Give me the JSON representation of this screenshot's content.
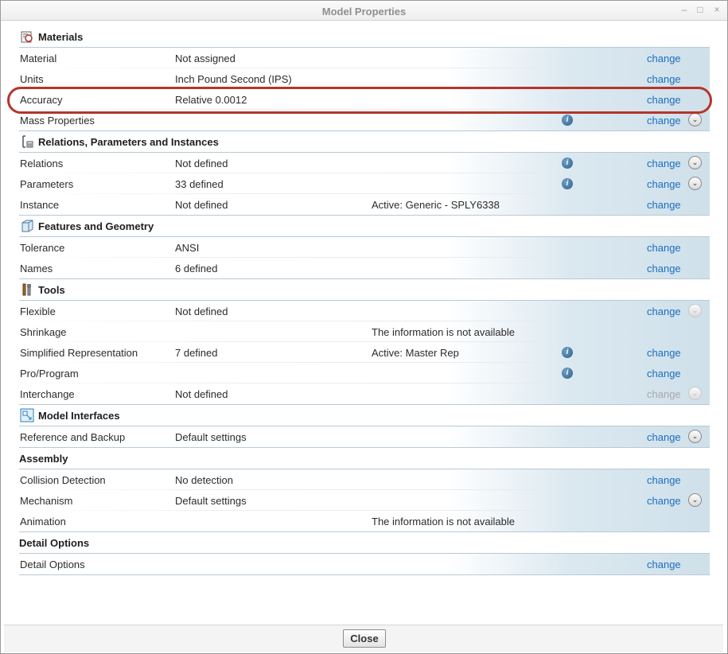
{
  "window": {
    "title": "Model Properties",
    "minimize": "–",
    "maximize": "□",
    "close": "×"
  },
  "sections": {
    "materials": {
      "title": "Materials",
      "icon": "materials-icon",
      "rows": [
        {
          "name": "Material",
          "value": "Not assigned",
          "change": "change"
        },
        {
          "name": "Units",
          "value": "Inch Pound Second (IPS)",
          "change": "change"
        },
        {
          "name": "Accuracy",
          "value": "Relative 0.0012",
          "change": "change"
        },
        {
          "name": "Mass Properties",
          "help": "i",
          "change": "change",
          "expand": "⌄"
        }
      ]
    },
    "relations": {
      "title": "Relations, Parameters and Instances",
      "icon": "relations-icon",
      "rows": [
        {
          "name": "Relations",
          "value": "Not defined",
          "help": "i",
          "change": "change",
          "expand": "⌄"
        },
        {
          "name": "Parameters",
          "value": "33 defined",
          "help": "i",
          "change": "change",
          "expand": "⌄"
        },
        {
          "name": "Instance",
          "value": "Not defined",
          "info": "Active: Generic - SPLY6338",
          "change": "change"
        }
      ]
    },
    "features": {
      "title": "Features and Geometry",
      "icon": "features-icon",
      "rows": [
        {
          "name": "Tolerance",
          "value": "ANSI",
          "change": "change"
        },
        {
          "name": "Names",
          "value": "6 defined",
          "change": "change"
        }
      ]
    },
    "tools": {
      "title": "Tools",
      "icon": "tools-icon",
      "rows": [
        {
          "name": "Flexible",
          "value": "Not defined",
          "change": "change",
          "expand": "⌄"
        },
        {
          "name": "Shrinkage",
          "info": "The information is not available"
        },
        {
          "name": "Simplified Representation",
          "value": "7 defined",
          "info": "Active: Master Rep",
          "help": "i",
          "change": "change"
        },
        {
          "name": "Pro/Program",
          "help": "i",
          "change": "change"
        },
        {
          "name": "Interchange",
          "value": "Not defined",
          "change": "change",
          "expand": "⌄"
        }
      ]
    },
    "interfaces": {
      "title": "Model Interfaces",
      "icon": "model-interfaces-icon",
      "rows": [
        {
          "name": "Reference and Backup",
          "value": "Default settings",
          "change": "change",
          "expand": "⌄"
        }
      ]
    },
    "assembly": {
      "title": "Assembly",
      "rows": [
        {
          "name": "Collision Detection",
          "value": "No detection",
          "change": "change"
        },
        {
          "name": "Mechanism",
          "value": "Default settings",
          "change": "change",
          "expand": "⌄"
        },
        {
          "name": "Animation",
          "info": "The information is not available"
        }
      ]
    },
    "detail": {
      "title": "Detail Options",
      "rows": [
        {
          "name": "Detail Options",
          "change": "change"
        }
      ]
    }
  },
  "footer": {
    "close_label": "Close"
  },
  "colors": {
    "link": "#1c6ec0",
    "highlight": "#b5352b",
    "row_gradient_end": "#cfe0ea"
  }
}
